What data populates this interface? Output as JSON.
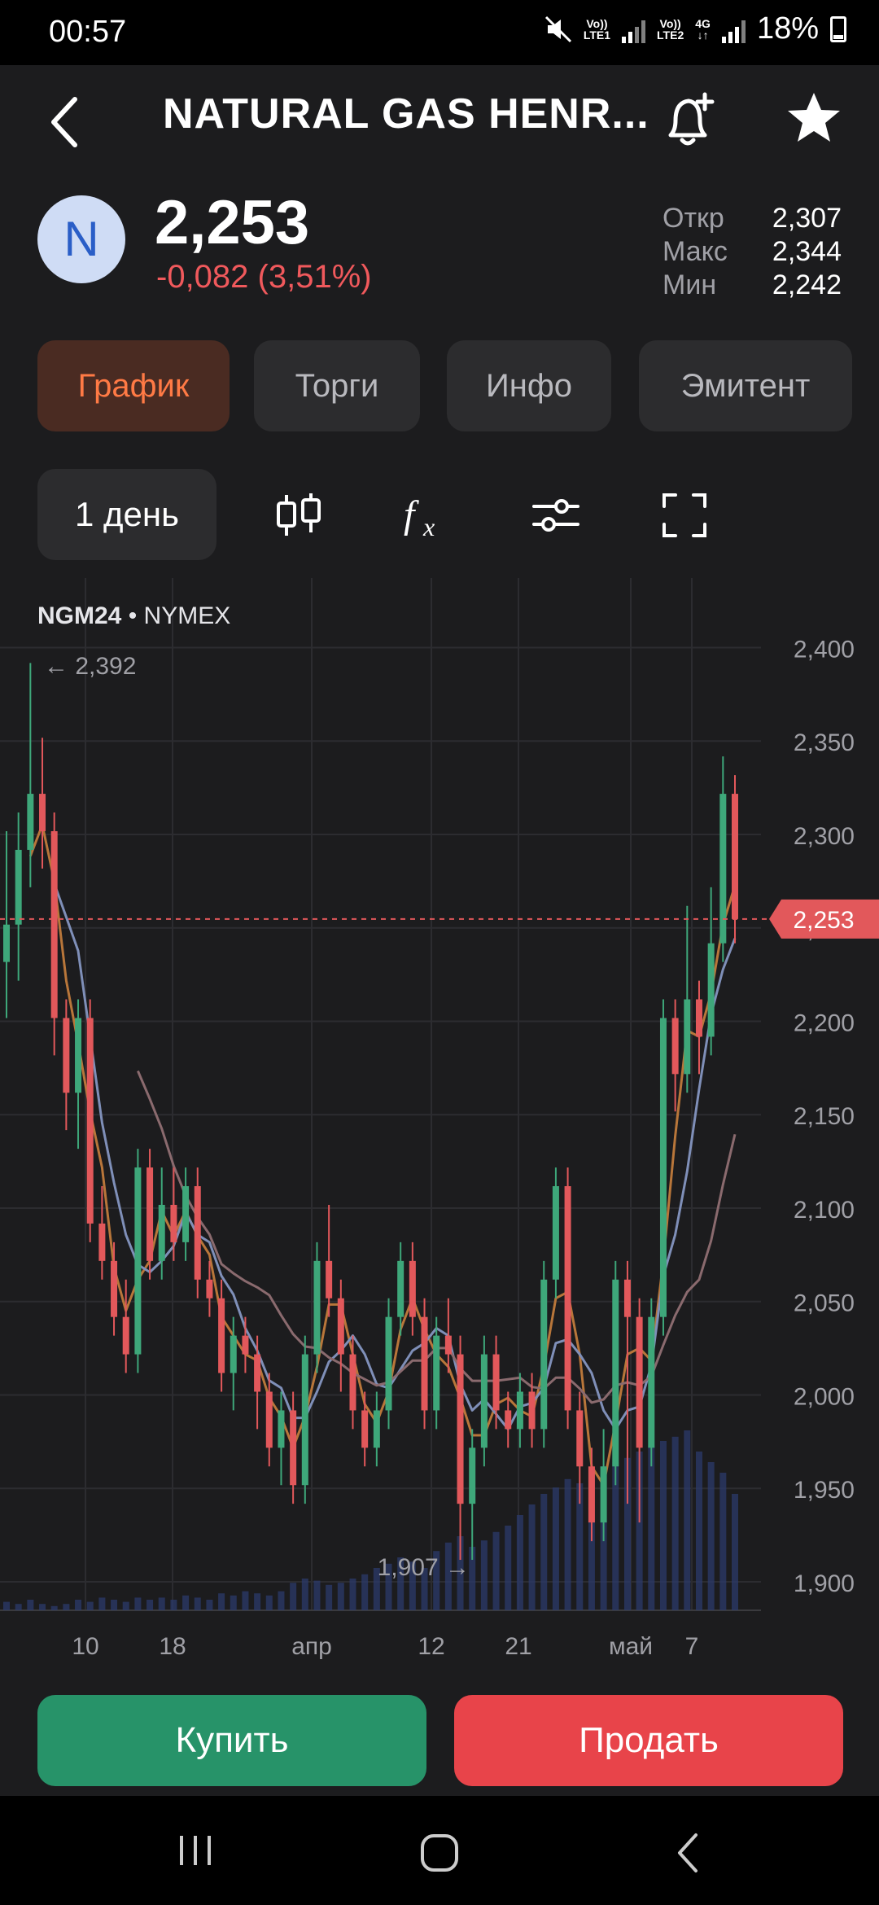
{
  "status_bar": {
    "time": "00:57",
    "sim1": "Vo)) LTE1",
    "sim2": "Vo)) LTE2",
    "network": "4G",
    "battery": "18%"
  },
  "header": {
    "title": "NATURAL GAS HENR...",
    "icons": [
      "back-icon",
      "bell-plus-icon",
      "star-icon"
    ]
  },
  "quote": {
    "avatar_letter": "N",
    "price": "2,253",
    "change": "-0,082 (3,51%)",
    "stats": [
      {
        "label": "Откр",
        "value": "2,307"
      },
      {
        "label": "Макс",
        "value": "2,344"
      },
      {
        "label": "Мин",
        "value": "2,242"
      }
    ]
  },
  "tabs": [
    {
      "label": "График",
      "active": true
    },
    {
      "label": "Торги",
      "active": false
    },
    {
      "label": "Инфо",
      "active": false
    },
    {
      "label": "Эмитент",
      "active": false
    }
  ],
  "toolbar": {
    "period": "1 день",
    "icons": [
      "candlestick-icon",
      "function-icon",
      "sliders-icon",
      "fullscreen-icon"
    ]
  },
  "chart": {
    "ticker": "NGM24",
    "exchange": "• NYMEX",
    "max_marker": "← 2,392",
    "min_marker": "1,907 →",
    "current_price_label": "2,253",
    "y_axis": [
      "2,400",
      "2,350",
      "2,300",
      "2,250",
      "2,200",
      "2,150",
      "2,100",
      "2,050",
      "2,000",
      "1,950",
      "1,900"
    ],
    "x_axis": [
      "10",
      "18",
      "апр",
      "12",
      "21",
      "май",
      "7"
    ]
  },
  "chart_data": {
    "type": "candlestick",
    "ylim": [
      1.87,
      2.42
    ],
    "current": 2.253,
    "max": 2.392,
    "min": 1.907,
    "candles": [
      [
        2.23,
        2.25,
        2.3,
        2.2
      ],
      [
        2.25,
        2.29,
        2.31,
        2.22
      ],
      [
        2.29,
        2.32,
        2.39,
        2.27
      ],
      [
        2.32,
        2.3,
        2.35,
        2.28
      ],
      [
        2.3,
        2.2,
        2.31,
        2.18
      ],
      [
        2.2,
        2.16,
        2.21,
        2.14
      ],
      [
        2.16,
        2.2,
        2.21,
        2.13
      ],
      [
        2.2,
        2.09,
        2.21,
        2.08
      ],
      [
        2.09,
        2.07,
        2.11,
        2.06
      ],
      [
        2.07,
        2.04,
        2.08,
        2.03
      ],
      [
        2.04,
        2.02,
        2.06,
        2.01
      ],
      [
        2.02,
        2.12,
        2.13,
        2.01
      ],
      [
        2.12,
        2.07,
        2.13,
        2.06
      ],
      [
        2.07,
        2.1,
        2.12,
        2.06
      ],
      [
        2.1,
        2.08,
        2.12,
        2.07
      ],
      [
        2.08,
        2.11,
        2.12,
        2.07
      ],
      [
        2.11,
        2.06,
        2.12,
        2.05
      ],
      [
        2.06,
        2.05,
        2.07,
        2.04
      ],
      [
        2.05,
        2.01,
        2.06,
        2.0
      ],
      [
        2.01,
        2.03,
        2.04,
        1.99
      ],
      [
        2.03,
        2.02,
        2.04,
        2.01
      ],
      [
        2.02,
        2.0,
        2.03,
        1.98
      ],
      [
        2.0,
        1.97,
        2.01,
        1.96
      ],
      [
        1.97,
        1.99,
        2.0,
        1.95
      ],
      [
        1.99,
        1.95,
        2.0,
        1.94
      ],
      [
        1.95,
        2.02,
        2.03,
        1.94
      ],
      [
        2.02,
        2.07,
        2.08,
        2.01
      ],
      [
        2.07,
        2.05,
        2.1,
        2.04
      ],
      [
        2.05,
        2.02,
        2.06,
        2.0
      ],
      [
        2.02,
        1.99,
        2.03,
        1.98
      ],
      [
        1.99,
        1.97,
        2.0,
        1.96
      ],
      [
        1.97,
        1.99,
        2.0,
        1.96
      ],
      [
        1.99,
        2.04,
        2.05,
        1.98
      ],
      [
        2.04,
        2.07,
        2.08,
        2.03
      ],
      [
        2.07,
        2.04,
        2.08,
        2.03
      ],
      [
        2.04,
        1.99,
        2.05,
        1.98
      ],
      [
        1.99,
        2.03,
        2.04,
        1.98
      ],
      [
        2.03,
        2.02,
        2.05,
        2.01
      ],
      [
        2.02,
        1.94,
        2.03,
        1.91
      ],
      [
        1.94,
        1.97,
        1.98,
        1.91
      ],
      [
        1.97,
        2.02,
        2.03,
        1.96
      ],
      [
        2.02,
        1.99,
        2.03,
        1.98
      ],
      [
        1.99,
        1.98,
        2.0,
        1.97
      ],
      [
        1.98,
        2.0,
        2.01,
        1.97
      ],
      [
        2.0,
        1.98,
        2.01,
        1.97
      ],
      [
        1.98,
        2.06,
        2.07,
        1.97
      ],
      [
        2.06,
        2.11,
        2.12,
        2.05
      ],
      [
        2.11,
        1.99,
        2.12,
        1.98
      ],
      [
        1.99,
        1.96,
        2.0,
        1.94
      ],
      [
        1.96,
        1.93,
        1.97,
        1.92
      ],
      [
        1.93,
        1.96,
        1.98,
        1.92
      ],
      [
        1.96,
        2.06,
        2.07,
        1.95
      ],
      [
        2.06,
        2.04,
        2.07,
        1.94
      ],
      [
        2.04,
        1.97,
        2.05,
        1.93
      ],
      [
        1.97,
        2.04,
        2.05,
        1.96
      ],
      [
        2.04,
        2.2,
        2.21,
        2.03
      ],
      [
        2.2,
        2.17,
        2.21,
        2.15
      ],
      [
        2.17,
        2.21,
        2.26,
        2.16
      ],
      [
        2.21,
        2.19,
        2.22,
        2.17
      ],
      [
        2.19,
        2.24,
        2.27,
        2.18
      ],
      [
        2.24,
        2.32,
        2.34,
        2.23
      ],
      [
        2.32,
        2.253,
        2.33,
        2.24
      ]
    ],
    "volumes": [
      0.04,
      0.03,
      0.05,
      0.03,
      0.02,
      0.03,
      0.05,
      0.04,
      0.06,
      0.05,
      0.04,
      0.06,
      0.05,
      0.06,
      0.05,
      0.07,
      0.06,
      0.05,
      0.08,
      0.07,
      0.09,
      0.08,
      0.07,
      0.09,
      0.13,
      0.15,
      0.14,
      0.12,
      0.13,
      0.15,
      0.17,
      0.2,
      0.22,
      0.25,
      0.23,
      0.2,
      0.28,
      0.32,
      0.35,
      0.3,
      0.33,
      0.37,
      0.4,
      0.45,
      0.5,
      0.55,
      0.58,
      0.62,
      0.6,
      0.65,
      0.68,
      0.7,
      0.72,
      0.75,
      0.78,
      0.8,
      0.82,
      0.85,
      0.75,
      0.7,
      0.65,
      0.55
    ]
  },
  "actions": {
    "buy": "Купить",
    "sell": "Продать"
  },
  "navbar": [
    "recent-apps-icon",
    "home-icon",
    "back-icon"
  ]
}
